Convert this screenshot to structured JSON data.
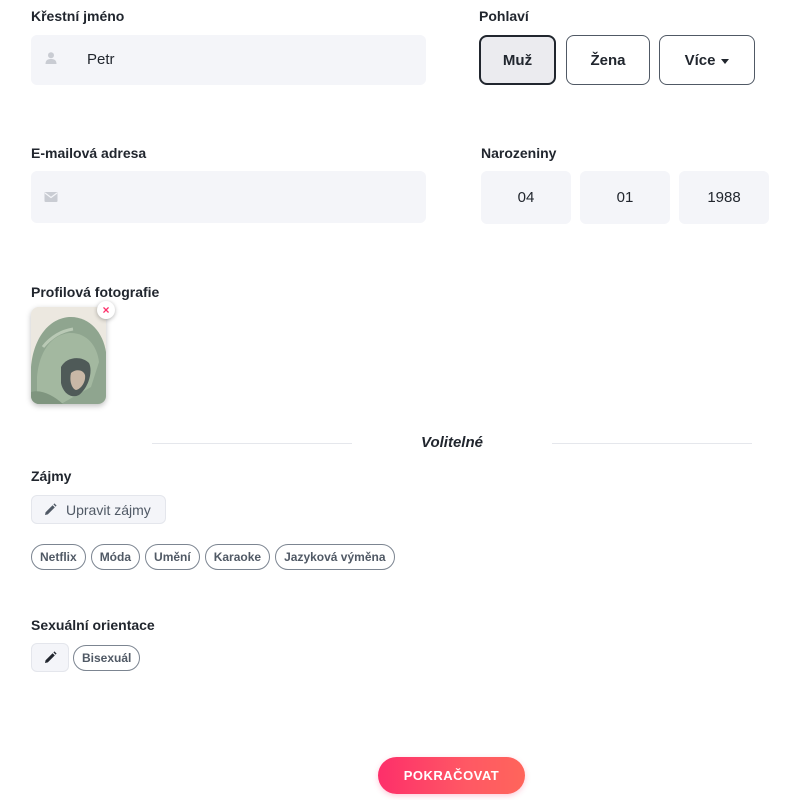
{
  "first_name": {
    "label": "Křestní jméno",
    "value": "Petr",
    "icon": "user-icon"
  },
  "gender": {
    "label": "Pohlaví",
    "options": [
      "Muž",
      "Žena",
      "Více"
    ],
    "selected": "Muž"
  },
  "email": {
    "label": "E-mailová adresa",
    "value": "",
    "icon": "envelope-icon"
  },
  "birthday": {
    "label": "Narozeniny",
    "day": "04",
    "month": "01",
    "year": "1988"
  },
  "photo": {
    "label": "Profilová fotografie",
    "remove_glyph": "×"
  },
  "optional_heading": "Volitelné",
  "interests": {
    "label": "Zájmy",
    "edit_label": "Upravit zájmy",
    "chips": [
      "Netflix",
      "Móda",
      "Umění",
      "Karaoke",
      "Jazyková výměna"
    ]
  },
  "orientation": {
    "label": "Sexuální orientace",
    "chips": [
      "Bisexuál"
    ]
  },
  "continue_label": "POKRAČOVAT",
  "colors": {
    "accent": "#fd2f6a",
    "field_bg": "#f4f5f9",
    "text": "#21262e"
  }
}
